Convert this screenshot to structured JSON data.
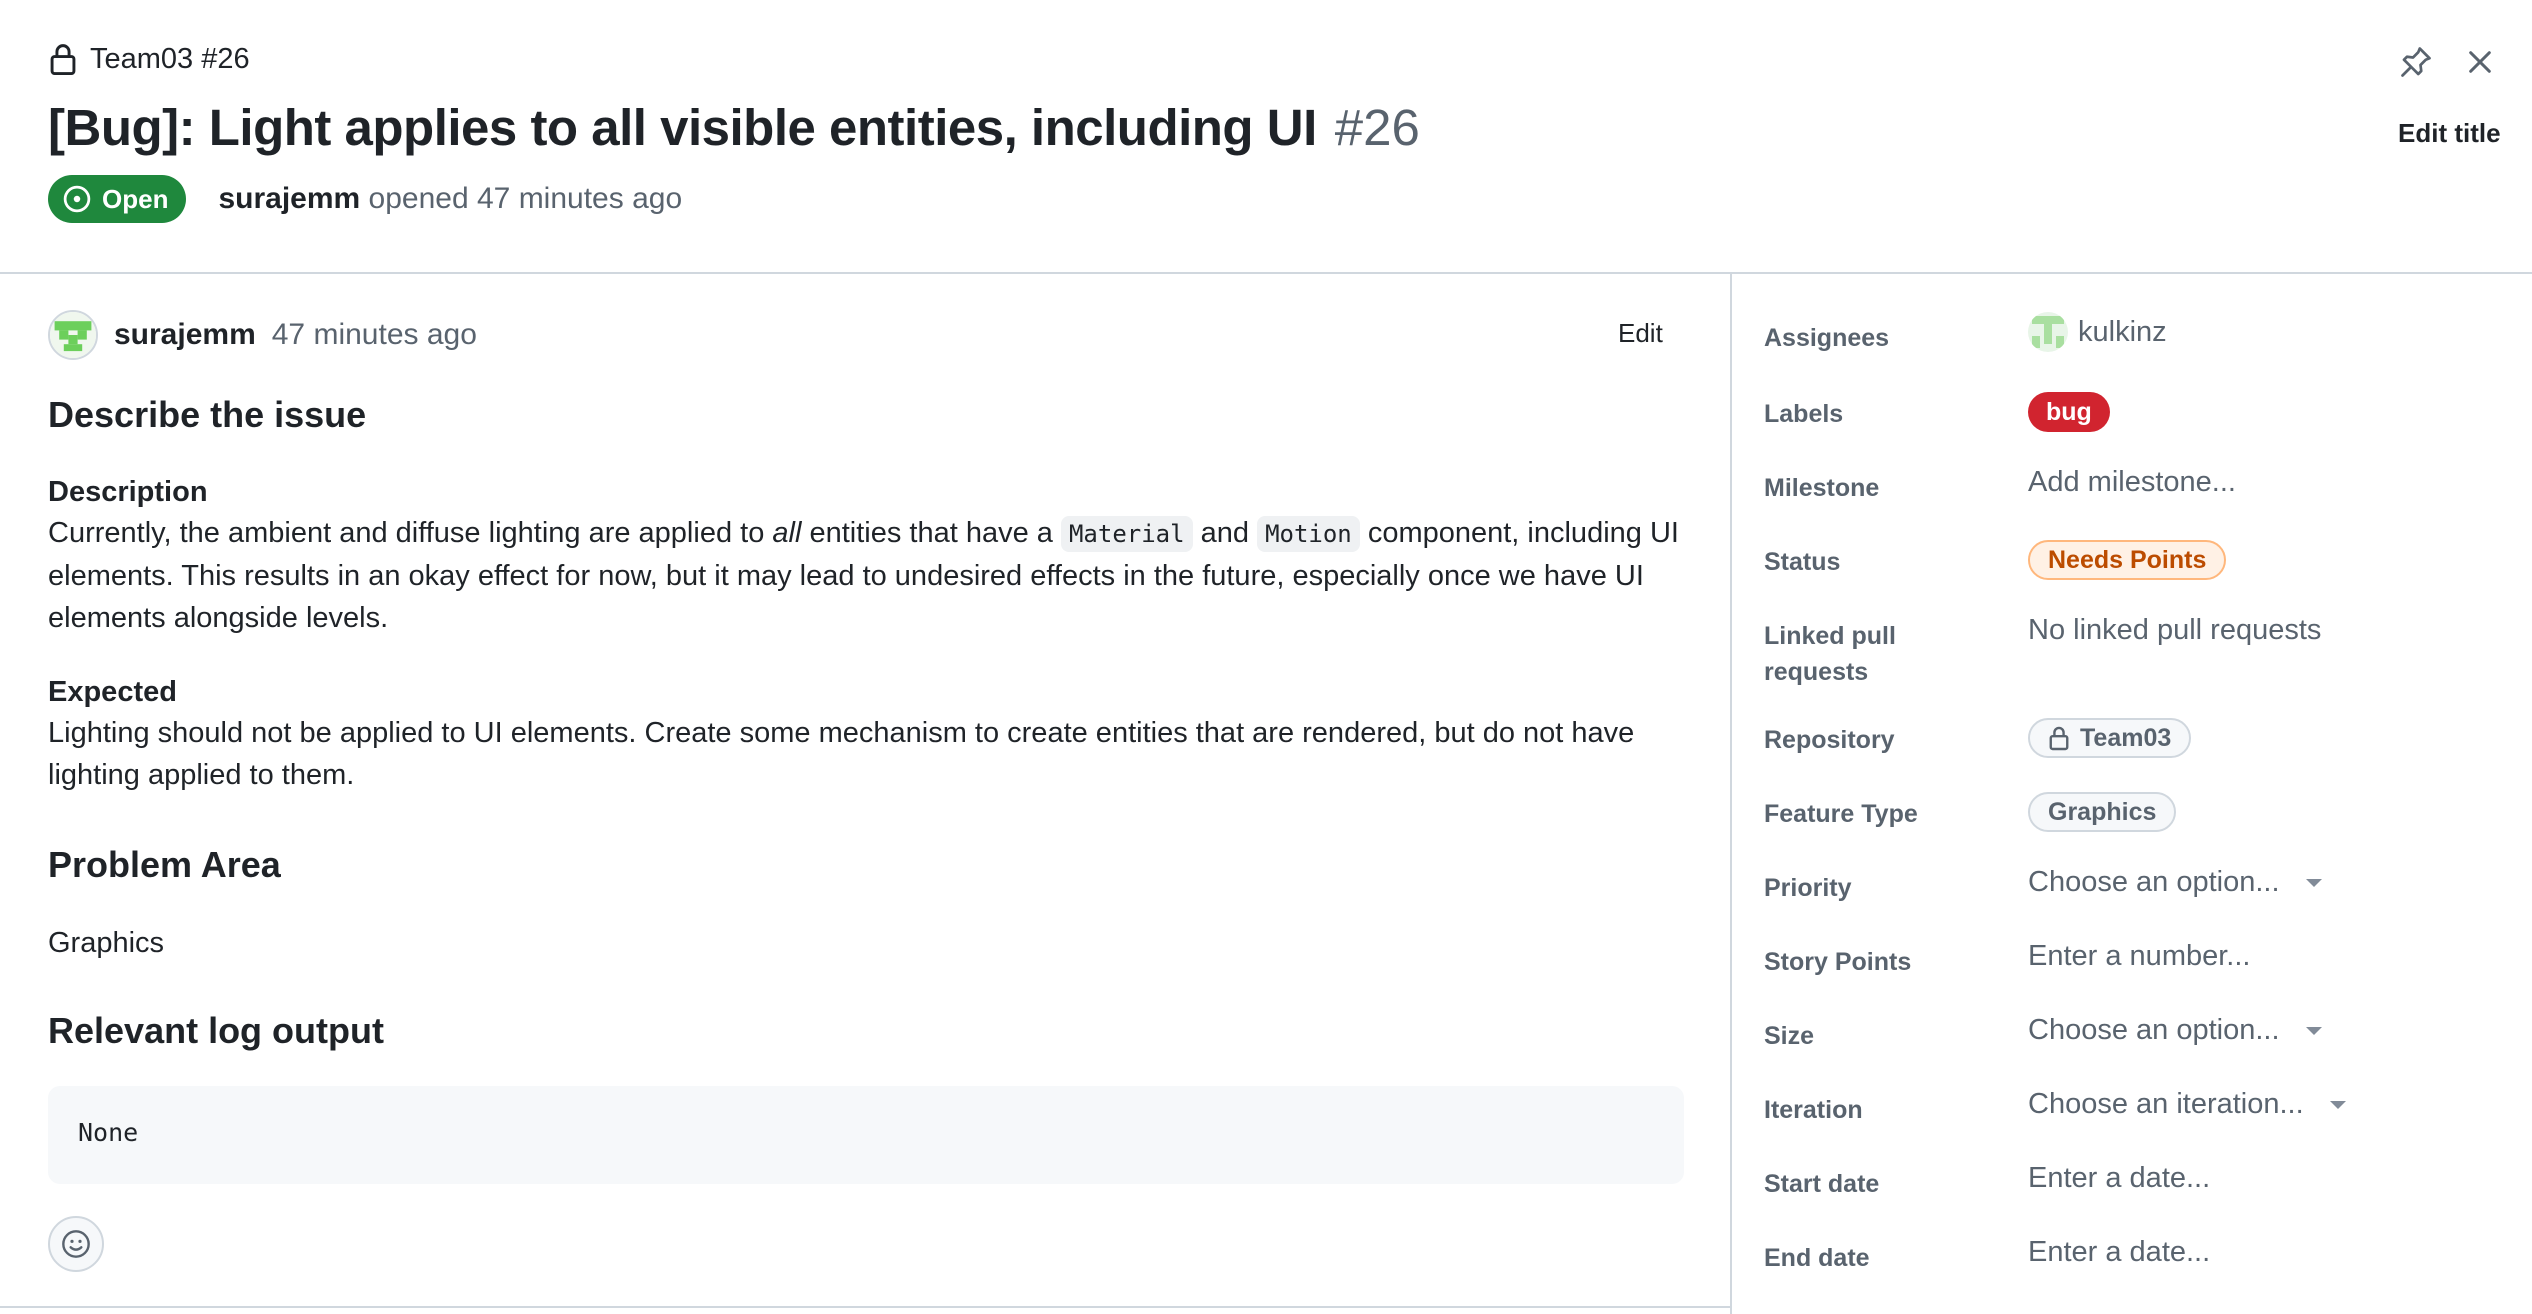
{
  "header": {
    "repo_crumb": "Team03 #26",
    "title": "[Bug]: Light applies to all visible entities, including UI",
    "issue_number": "#26",
    "state_label": "Open",
    "author": "surajemm",
    "opened_text": "opened 47 minutes ago",
    "edit_title_label": "Edit title"
  },
  "comment": {
    "author": "surajemm",
    "time": "47 minutes ago",
    "edit_label": "Edit",
    "describe_heading": "Describe the issue",
    "description_heading": "Description",
    "description_part1": "Currently, the ambient and diffuse lighting are applied to ",
    "description_emphasis": "all",
    "description_part2": " entities that have a ",
    "code_material": "Material",
    "description_and": " and ",
    "code_motion": "Motion",
    "description_part3": " component, including UI elements. This results in an okay effect for now, but it may lead to undesired effects in the future, especially once we have UI elements alongside levels.",
    "expected_heading": "Expected",
    "expected_text": "Lighting should not be applied to UI elements. Create some mechanism to create entities that are rendered, but do not have lighting applied to them.",
    "problem_area_heading": "Problem Area",
    "problem_area_value": "Graphics",
    "log_heading": "Relevant log output",
    "log_value": "None"
  },
  "sidebar": {
    "assignees_label": "Assignees",
    "assignee_name": "kulkinz",
    "labels_label": "Labels",
    "label_bug": "bug",
    "milestone_label": "Milestone",
    "milestone_value": "Add milestone...",
    "status_label": "Status",
    "status_value": "Needs Points",
    "linked_pr_label": "Linked pull requests",
    "linked_pr_value": "No linked pull requests",
    "repository_label": "Repository",
    "repository_value": "Team03",
    "feature_type_label": "Feature Type",
    "feature_type_value": "Graphics",
    "priority_label": "Priority",
    "priority_value": "Choose an option...",
    "story_points_label": "Story Points",
    "story_points_value": "Enter a number...",
    "size_label": "Size",
    "size_value": "Choose an option...",
    "iteration_label": "Iteration",
    "iteration_value": "Choose an iteration...",
    "start_date_label": "Start date",
    "start_date_value": "Enter a date...",
    "end_date_label": "End date",
    "end_date_value": "Enter a date..."
  },
  "colors": {
    "open_green": "#1f883d",
    "bug_red": "#d1242f",
    "status_orange": "#bc4c00",
    "muted_text": "#59636e",
    "border": "#d0d7de"
  },
  "icons": [
    "lock-icon",
    "pin-icon",
    "close-icon",
    "issue-open-icon",
    "smiley-icon",
    "chevron-down-icon"
  ]
}
